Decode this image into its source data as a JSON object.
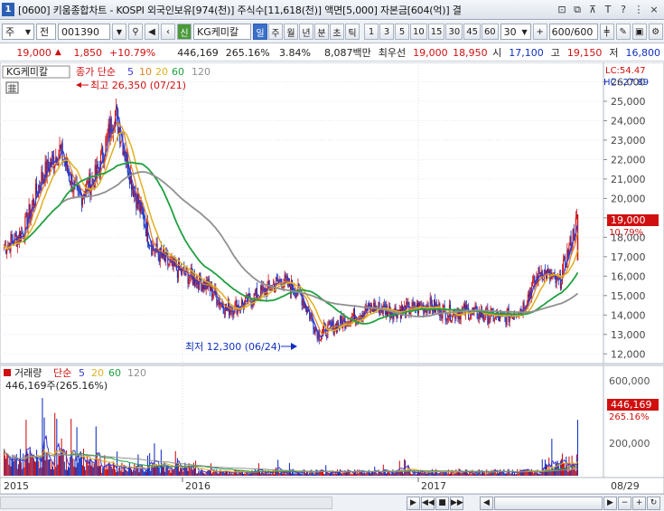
{
  "window": {
    "number": "1",
    "title": "[0600] 키움종합차트 - KOSPI 외국인보유[974(천)] 주식수[11,618(천)] 액면[5,000] 자본금[604(억)] 결",
    "buttons": [
      "⊡",
      "⧉",
      "⊼",
      "T",
      "?",
      "⋮",
      "×"
    ]
  },
  "toolbar": {
    "market": "주",
    "category": "전",
    "code": "001390",
    "new_label": "신",
    "stock_name": "KG케미칼",
    "periods": [
      "일",
      "주",
      "월",
      "년",
      "분",
      "초",
      "틱"
    ],
    "active_period": "일",
    "intervals": [
      "1",
      "3",
      "5",
      "10",
      "15",
      "30",
      "45",
      "60"
    ],
    "count_select": "30",
    "view_count": "600",
    "view_total": "/600"
  },
  "quote": {
    "price": "19,000",
    "change": "1,850",
    "change_pct": "+10.79%",
    "volume": "446,169",
    "volume_ratio": "265.16%",
    "turnover": "3.84%",
    "amount": "8,087백만",
    "best_ask_label": "최우선",
    "best_ask": "19,000",
    "best_bid": "18,950",
    "open_label": "시",
    "open": "17,100",
    "high_label": "고",
    "high": "19,150",
    "low_label": "저",
    "low": "16,800"
  },
  "price_panel": {
    "legend_name": "KG케미칼",
    "legend_close": "종가 단순",
    "ma_periods": [
      "5",
      "10",
      "20",
      "60",
      "120"
    ],
    "lc_label": "LC:54.47",
    "hc_label": "HC:-27.89",
    "high_annotation": "최고 26,350 (07/21)",
    "low_annotation": "최저 12,300 (06/24)",
    "current_price_tag": "19,000",
    "current_pct_tag": "10.79%",
    "y_ticks": [
      "26,000",
      "25,000",
      "24,000",
      "23,000",
      "22,000",
      "21,000",
      "20,000",
      "19,000",
      "18,000",
      "17,000",
      "16,000",
      "15,000",
      "14,000",
      "13,000",
      "12,000"
    ]
  },
  "volume_panel": {
    "legend_name": "거래량",
    "legend_ma": "단순",
    "ma_periods": [
      "5",
      "20",
      "60",
      "120"
    ],
    "current_volume": "446,169주(265.16%)",
    "current_tag": "446,169",
    "current_pct_tag": "265.16%",
    "y_ticks": [
      "600,000",
      "200,000"
    ]
  },
  "x_axis": {
    "labels": [
      "2015",
      "2016",
      "2017"
    ],
    "last_date": "08/29"
  },
  "colors": {
    "ma5": "#3a3ad0",
    "ma10": "#e08020",
    "ma20": "#e0b020",
    "ma60": "#20a040",
    "ma120": "#909090",
    "up": "#d01010",
    "down": "#1030c0"
  },
  "chart_data": {
    "type": "line",
    "series": [
      {
        "name": "종가",
        "x": [
          "2015-01",
          "2015-02",
          "2015-03",
          "2015-04",
          "2015-05",
          "2015-06",
          "2015-07",
          "2015-08",
          "2015-09",
          "2015-10",
          "2015-11",
          "2015-12",
          "2016-01",
          "2016-02",
          "2016-03",
          "2016-04",
          "2016-05",
          "2016-06",
          "2016-07",
          "2016-08",
          "2016-09",
          "2016-10",
          "2016-11",
          "2016-12",
          "2017-01",
          "2017-02",
          "2017-03",
          "2017-04",
          "2017-05",
          "2017-06",
          "2017-07",
          "2017-08"
        ],
        "values": [
          17500,
          18200,
          21000,
          22500,
          20000,
          21200,
          24500,
          20500,
          17500,
          16500,
          16000,
          15500,
          14300,
          14600,
          15200,
          15800,
          15100,
          13000,
          13500,
          14000,
          14400,
          14200,
          14300,
          14500,
          14100,
          14200,
          14000,
          13800,
          14400,
          16300,
          15600,
          19000
        ]
      }
    ],
    "ylim": [
      12000,
      26350
    ]
  }
}
